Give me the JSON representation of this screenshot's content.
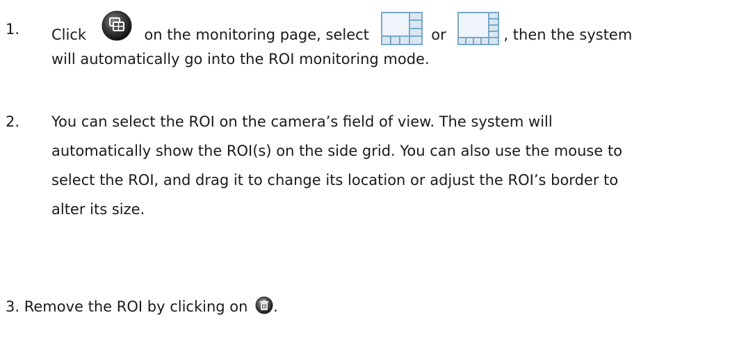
{
  "steps": [
    {
      "number": "1.",
      "line1_a": "Click",
      "line1_b": "on the monitoring page, select",
      "line1_c": "or",
      "line1_d": ", then the system",
      "line2": "will automatically go into the ROI monitoring mode.",
      "icons": [
        "monitor-layout-icon",
        "roi-layout-grid-icon-a",
        "roi-layout-grid-icon-b"
      ]
    },
    {
      "number": "2.",
      "lines": [
        "You can select the ROI on the camera’s field of view. The system will",
        "automatically show the ROI(s) on the side grid. You can also use the mouse to",
        "select the ROI, and drag it to change its location or adjust the ROI’s border to",
        "alter its size."
      ]
    },
    {
      "number": "3.",
      "text": "Remove the ROI by clicking on",
      "after_icon": ".",
      "icons": [
        "trash-icon"
      ]
    }
  ],
  "colors": {
    "text": "#1a1a1a",
    "icon_dark": "#3a3a3a",
    "grid_blue": "#7aa7c7",
    "grid_fill": "#d9e7f2"
  }
}
